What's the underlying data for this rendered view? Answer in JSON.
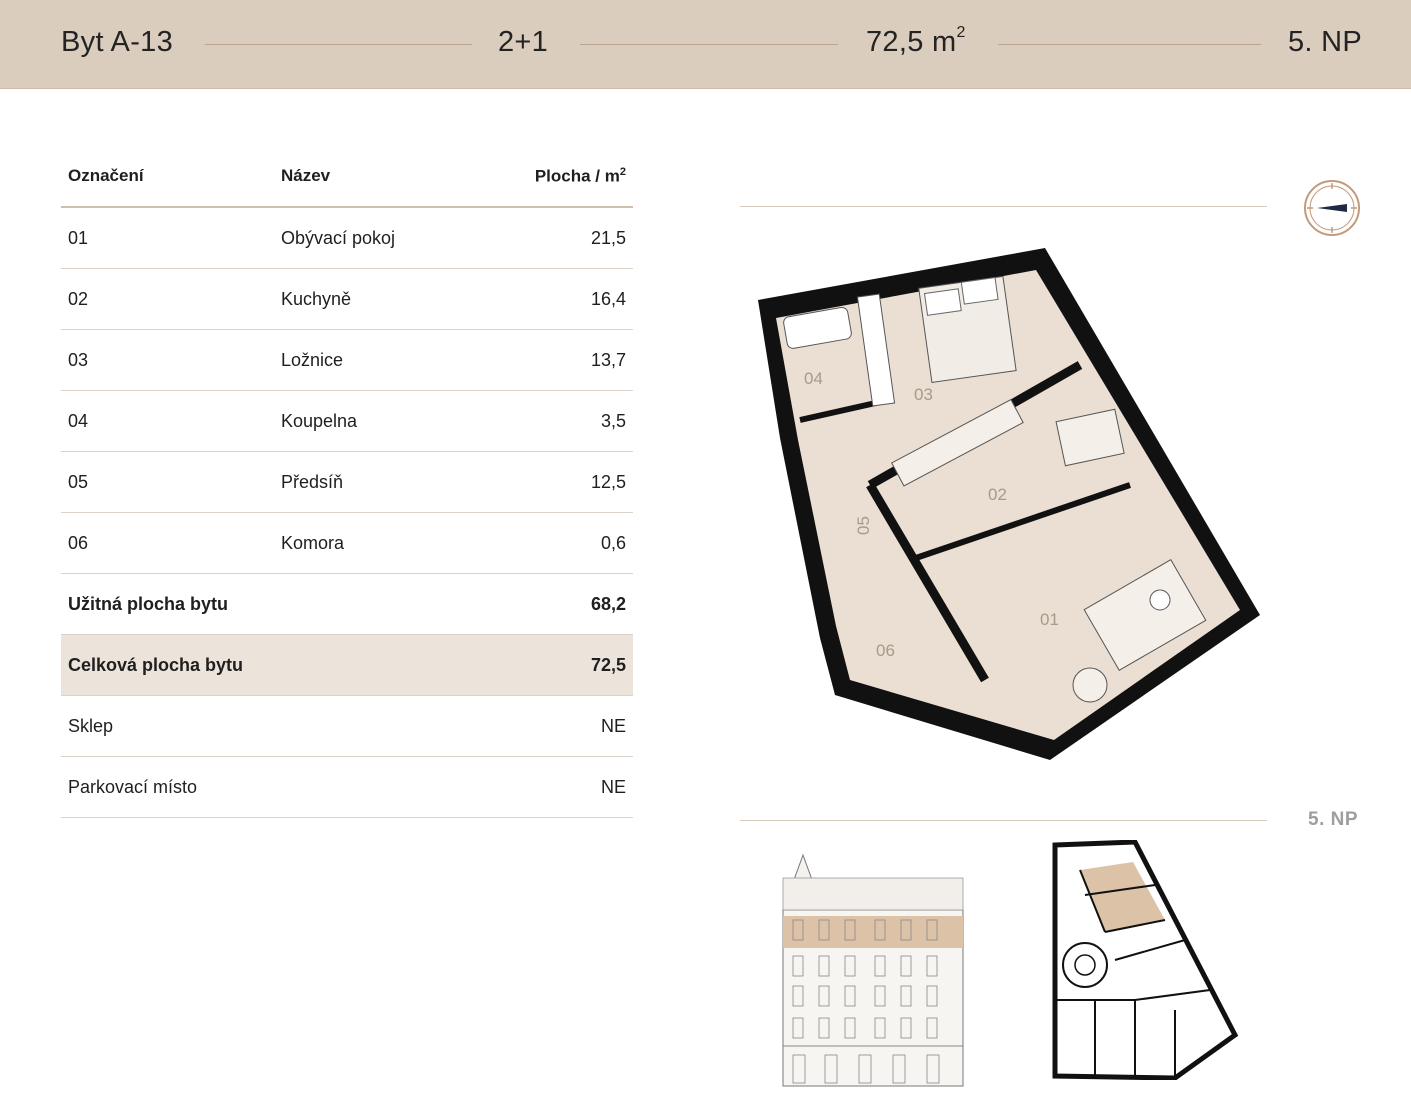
{
  "header": {
    "unit": "Byt A-13",
    "layout": "2+1",
    "area": "72,5 m",
    "area_sup": "2",
    "floor": "5. NP"
  },
  "table": {
    "columns": [
      "Označení",
      "Název",
      "Plocha / m"
    ],
    "columns_sup": "2",
    "rows": [
      {
        "id": "01",
        "name": "Obývací pokoj",
        "area": "21,5"
      },
      {
        "id": "02",
        "name": "Kuchyně",
        "area": "16,4"
      },
      {
        "id": "03",
        "name": "Ložnice",
        "area": "13,7"
      },
      {
        "id": "04",
        "name": "Koupelna",
        "area": "3,5"
      },
      {
        "id": "05",
        "name": "Předsíň",
        "area": "12,5"
      },
      {
        "id": "06",
        "name": "Komora",
        "area": "0,6"
      }
    ],
    "usable": {
      "label": "Užitná plocha bytu",
      "value": "68,2"
    },
    "total": {
      "label": "Celková plocha bytu",
      "value": "72,5"
    },
    "cellar": {
      "label": "Sklep",
      "value": "NE"
    },
    "parking": {
      "label": "Parkovací místo",
      "value": "NE"
    }
  },
  "plan": {
    "room_labels": [
      "01",
      "02",
      "03",
      "04",
      "05",
      "06"
    ],
    "floor_label": "5. NP",
    "icons": [
      "compass-icon"
    ]
  },
  "colors": {
    "header_bg": "#dbcdbd",
    "highlight_row": "#ece3da",
    "room_fill": "#eadfd2",
    "wall": "#111111",
    "accent": "#c39a7a"
  }
}
